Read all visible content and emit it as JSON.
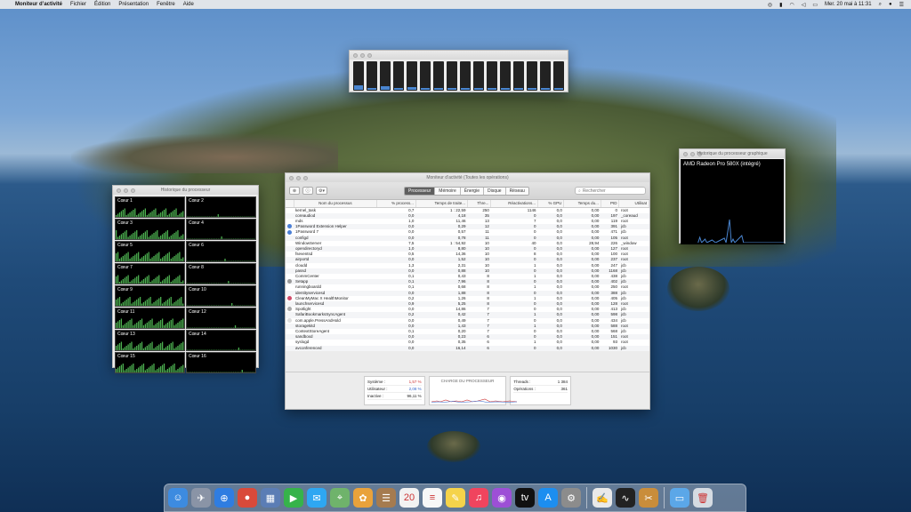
{
  "menubar": {
    "app_name": "Moniteur d’activité",
    "menus": [
      "Fichier",
      "Édition",
      "Présentation",
      "Fenêtre",
      "Aide"
    ],
    "clock": "Mer. 20 mai à 11:31"
  },
  "cpu_float": {
    "core_loads": [
      0.15,
      0.05,
      0.12,
      0.04,
      0.1,
      0.03,
      0.08,
      0.03,
      0.06,
      0.02,
      0.05,
      0.02,
      0.04,
      0.02,
      0.03,
      0.02
    ]
  },
  "history": {
    "title": "Historique du processeur",
    "cores": [
      "Cœur 1",
      "Cœur 2",
      "Cœur 3",
      "Cœur 4",
      "Cœur 5",
      "Cœur 6",
      "Cœur 7",
      "Cœur 8",
      "Cœur 9",
      "Cœur 10",
      "Cœur 11",
      "Cœur 12",
      "Cœur 13",
      "Cœur 14",
      "Cœur 15",
      "Cœur 16"
    ]
  },
  "gpu": {
    "title": "Historique du processeur graphique",
    "name": "AMD Radeon Pro 580X (intégré)"
  },
  "main": {
    "title": "Moniteur d’activité (Toutes les opérations)",
    "tabs": [
      "Processeur",
      "Mémoire",
      "Énergie",
      "Disque",
      "Réseau"
    ],
    "active_tab": 0,
    "search_placeholder": "Rechercher",
    "columns": [
      "Nom du processus",
      "% process...",
      "Temps de traite...",
      "Thre...",
      "Réactivations...",
      "% GPU",
      "Temps du...",
      "PID",
      "Utilisat"
    ],
    "rows": [
      [
        "kernel_task",
        "0,7",
        "1 : 22,59",
        "250",
        "1146",
        "0,0",
        "0,00",
        "0",
        "root"
      ],
      [
        "coreaudiod",
        "0,0",
        "4,18",
        "35",
        "0",
        "0,0",
        "0,00",
        "197",
        "_coreaud"
      ],
      [
        "mds",
        "1,0",
        "11,46",
        "13",
        "7",
        "0,0",
        "0,00",
        "119",
        "root"
      ],
      [
        "1Password Extension Helper",
        "0,0",
        "0,29",
        "12",
        "0",
        "0,0",
        "0,00",
        "391",
        "jcb"
      ],
      [
        "1Password 7",
        "0,0",
        "0,57",
        "11",
        "0",
        "0,0",
        "0,00",
        "471",
        "jcb"
      ],
      [
        "configd",
        "0,0",
        "0,78",
        "11",
        "0",
        "0,0",
        "0,00",
        "105",
        "root"
      ],
      [
        "WindowServer",
        "7,5",
        "1 : 54,92",
        "10",
        "40",
        "0,0",
        "28,94",
        "226",
        "_window"
      ],
      [
        "opendirectoryd",
        "1,0",
        "8,80",
        "10",
        "0",
        "0,0",
        "0,00",
        "127",
        "root"
      ],
      [
        "fseventsd",
        "0,5",
        "14,36",
        "10",
        "8",
        "0,0",
        "0,00",
        "100",
        "root"
      ],
      [
        "airportd",
        "0,0",
        "1,52",
        "10",
        "0",
        "0,0",
        "0,00",
        "237",
        "root"
      ],
      [
        "cloudd",
        "1,3",
        "2,31",
        "10",
        "1",
        "0,0",
        "0,00",
        "247",
        "jcb"
      ],
      [
        "passd",
        "0,0",
        "0,88",
        "10",
        "0",
        "0,0",
        "0,00",
        "1168",
        "jcb"
      ],
      [
        "CommCenter",
        "0,1",
        "0,43",
        "8",
        "1",
        "0,0",
        "0,00",
        "438",
        "jcb"
      ],
      [
        "Setapp",
        "0,1",
        "7,96",
        "8",
        "0",
        "0,0",
        "0,00",
        "402",
        "jcb"
      ],
      [
        "runningboardd",
        "0,1",
        "0,68",
        "8",
        "1",
        "0,0",
        "0,00",
        "250",
        "root"
      ],
      [
        "identityservicesd",
        "0,0",
        "1,88",
        "8",
        "0",
        "0,0",
        "0,00",
        "388",
        "jcb"
      ],
      [
        "CleanMyMac X HealthMonitor",
        "0,2",
        "1,26",
        "8",
        "1",
        "0,0",
        "0,00",
        "405",
        "jcb"
      ],
      [
        "launchservicesd",
        "0,9",
        "5,25",
        "8",
        "0",
        "0,0",
        "0,00",
        "128",
        "root"
      ],
      [
        "Spotlight",
        "0,0",
        "14,86",
        "7",
        "0",
        "0,0",
        "0,00",
        "413",
        "jcb"
      ],
      [
        "SafariBookmarksSyncAgent",
        "0,2",
        "0,42",
        "7",
        "1",
        "0,0",
        "0,00",
        "598",
        "jcb"
      ],
      [
        "com.apple.PressAndHold",
        "0,0",
        "0,49",
        "7",
        "0",
        "0,0",
        "0,00",
        "434",
        "jcb"
      ],
      [
        "storagekitd",
        "0,0",
        "1,43",
        "7",
        "1",
        "0,0",
        "0,00",
        "588",
        "root"
      ],
      [
        "ContextStoreAgent",
        "0,1",
        "0,20",
        "7",
        "0",
        "0,0",
        "0,00",
        "568",
        "jcb"
      ],
      [
        "sandboxd",
        "0,0",
        "0,23",
        "6",
        "0",
        "0,0",
        "0,00",
        "151",
        "root"
      ],
      [
        "syslogd",
        "0,0",
        "0,35",
        "6",
        "1",
        "0,0",
        "0,00",
        "93",
        "root"
      ],
      [
        "avconferenced",
        "0,0",
        "16,14",
        "6",
        "0",
        "0,0",
        "0,00",
        "1030",
        "jcb"
      ]
    ],
    "footer": {
      "left": [
        {
          "label": "Système :",
          "value": "1,57 %"
        },
        {
          "label": "Utilisateur :",
          "value": "2,08 %"
        },
        {
          "label": "Inactive :",
          "value": "96,11 %"
        }
      ],
      "chart_title": "CHARGE DU PROCESSEUR",
      "right": [
        {
          "label": "Threads :",
          "value": "1 384"
        },
        {
          "label": "Opérations :",
          "value": "361"
        }
      ]
    }
  },
  "dock": {
    "icons": [
      {
        "name": "finder-icon",
        "glyph": "☺",
        "color": "#3d8be0"
      },
      {
        "name": "launchpad-icon",
        "glyph": "✈",
        "color": "#8a94a6"
      },
      {
        "name": "safari-icon",
        "glyph": "⊕",
        "color": "#2f7de1"
      },
      {
        "name": "chrome-icon",
        "glyph": "●",
        "color": "#d94a3a"
      },
      {
        "name": "preview-icon",
        "glyph": "▦",
        "color": "#5b7db5"
      },
      {
        "name": "facetime-icon",
        "glyph": "▶",
        "color": "#36b34a"
      },
      {
        "name": "messages-icon",
        "glyph": "✉",
        "color": "#2ea7f2"
      },
      {
        "name": "maps-icon",
        "glyph": "⌖",
        "color": "#6fb36b"
      },
      {
        "name": "photos-icon",
        "glyph": "✿",
        "color": "#e9a23b"
      },
      {
        "name": "contacts-icon",
        "glyph": "☰",
        "color": "#a57b4f"
      },
      {
        "name": "calendar-icon",
        "glyph": "20",
        "color": "#f2f2f2"
      },
      {
        "name": "reminders-icon",
        "glyph": "≡",
        "color": "#f7f7f7"
      },
      {
        "name": "notes-icon",
        "glyph": "✎",
        "color": "#f5d34a"
      },
      {
        "name": "music-icon",
        "glyph": "♫",
        "color": "#f0445e"
      },
      {
        "name": "podcasts-icon",
        "glyph": "◉",
        "color": "#9d4fd6"
      },
      {
        "name": "tv-icon",
        "glyph": "tv",
        "color": "#111111"
      },
      {
        "name": "app-store-icon",
        "glyph": "A",
        "color": "#1c8ef0"
      },
      {
        "name": "system-preferences-icon",
        "glyph": "⚙",
        "color": "#8c8c8c"
      },
      {
        "name": "textedit-icon",
        "glyph": "✍",
        "color": "#e9e9e9"
      },
      {
        "name": "activity-monitor-icon",
        "glyph": "∿",
        "color": "#222222"
      },
      {
        "name": "script-editor-icon",
        "glyph": "✂",
        "color": "#c98d3b"
      },
      {
        "name": "downloads-folder-icon",
        "glyph": "▭",
        "color": "#5ba7e8"
      },
      {
        "name": "trash-icon",
        "glyph": "🗑",
        "color": "#d5dbe2"
      }
    ]
  }
}
